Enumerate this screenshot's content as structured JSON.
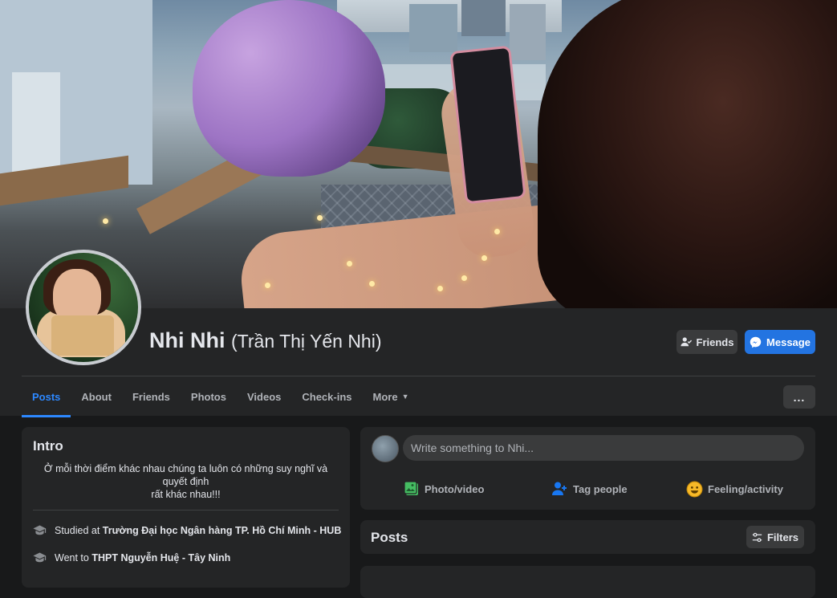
{
  "profile": {
    "name": "Nhi Nhi",
    "alternate_name": "(Trần Thị Yến Nhi)"
  },
  "actions": {
    "friends_label": "Friends",
    "message_label": "Message"
  },
  "tabs": [
    {
      "label": "Posts",
      "active": true
    },
    {
      "label": "About"
    },
    {
      "label": "Friends"
    },
    {
      "label": "Photos"
    },
    {
      "label": "Videos"
    },
    {
      "label": "Check-ins"
    },
    {
      "label": "More"
    }
  ],
  "more_menu_label": "...",
  "intro": {
    "title": "Intro",
    "bio_line1": "Ở mỗi thời điểm khác nhau chúng ta luôn có những suy nghĩ và quyết định",
    "bio_line2": "rất khác nhau!!!",
    "education": [
      {
        "prefix": "Studied at",
        "school": "Trường Đại học Ngân hàng TP. Hồ Chí Minh - HUB"
      },
      {
        "prefix": "Went to",
        "school": "THPT Nguyễn Huệ - Tây Ninh"
      }
    ]
  },
  "composer": {
    "placeholder": "Write something to Nhi...",
    "photo_video": "Photo/video",
    "tag_people": "Tag people",
    "feeling": "Feeling/activity"
  },
  "posts": {
    "title": "Posts",
    "filters_label": "Filters"
  },
  "colors": {
    "accent": "#2d88ff",
    "message_button": "#2374e1",
    "card_bg": "#242526",
    "page_bg": "#18191a"
  }
}
